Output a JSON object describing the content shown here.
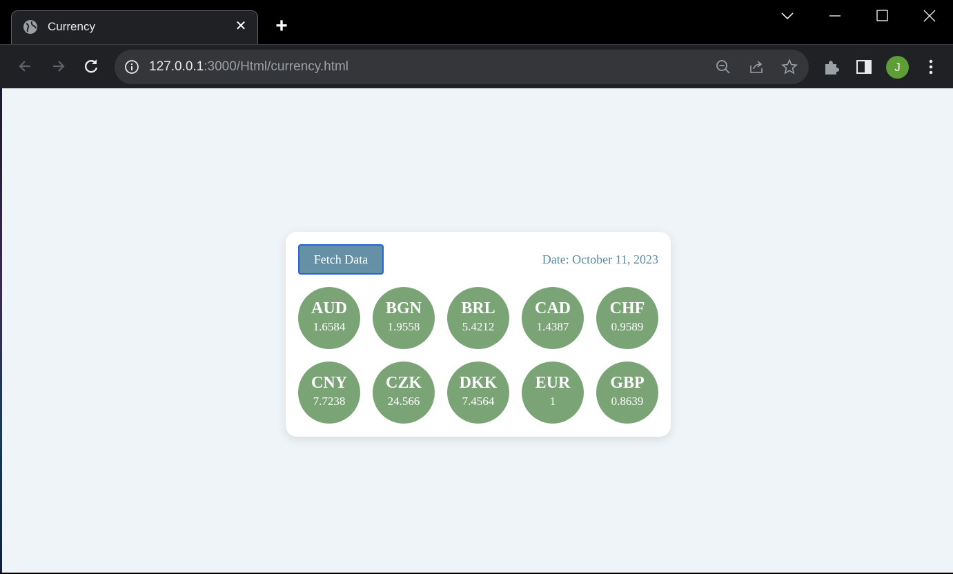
{
  "browser": {
    "tab_title": "Currency",
    "tab_close": "✕",
    "new_tab": "+",
    "url_host": "127.0.0.1",
    "url_rest": ":3000/Html/currency.html",
    "avatar_letter": "J"
  },
  "page": {
    "fetch_button_label": "Fetch Data",
    "date_text": "Date: October 11, 2023",
    "currencies": [
      {
        "code": "AUD",
        "rate": "1.6584"
      },
      {
        "code": "BGN",
        "rate": "1.9558"
      },
      {
        "code": "BRL",
        "rate": "5.4212"
      },
      {
        "code": "CAD",
        "rate": "1.4387"
      },
      {
        "code": "CHF",
        "rate": "0.9589"
      },
      {
        "code": "CNY",
        "rate": "7.7238"
      },
      {
        "code": "CZK",
        "rate": "24.566"
      },
      {
        "code": "DKK",
        "rate": "7.4564"
      },
      {
        "code": "EUR",
        "rate": "1"
      },
      {
        "code": "GBP",
        "rate": "0.8639"
      }
    ]
  },
  "colors": {
    "coin_bg": "#7ba476",
    "button_bg": "#6590a6",
    "page_bg": "#eef4f8",
    "avatar_bg": "#5f9e36"
  }
}
